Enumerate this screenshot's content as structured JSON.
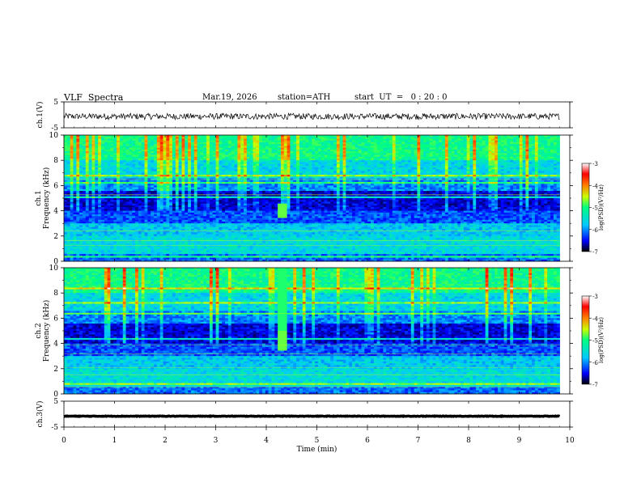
{
  "header": {
    "title": "VLF  Spectra",
    "date": "Mar.19, 2026",
    "station": "station=ATH",
    "start_ut": "start  UT  =   0 : 20 : 0"
  },
  "chart_data": [
    {
      "type": "line",
      "title": "",
      "ylabel": "ch.1(V)",
      "ylim": [
        -5,
        5
      ],
      "yticks": [
        "5",
        "-5"
      ],
      "series": [
        {
          "x_range": [
            0,
            9.8
          ],
          "baseline": -0.6,
          "amplitude_approx": 1.2
        }
      ],
      "color": "#000000"
    },
    {
      "type": "heatmap",
      "ylabel_line1": "ch.1",
      "ylabel_line2": "Frequency (kHz)",
      "ylim": [
        0,
        10
      ],
      "yticks": [
        "0",
        "2",
        "4",
        "6",
        "8",
        "10"
      ],
      "xlim": [
        0,
        10
      ],
      "data_xrange": [
        0,
        9.8
      ],
      "colorbar": {
        "label": "log(PSD)(V²/Hz)",
        "range": [
          -7,
          -3
        ],
        "ticks": [
          "-3",
          "-4",
          "-5",
          "-6",
          "-7"
        ],
        "colors": [
          "#000000",
          "#0000ff",
          "#00c8ff",
          "#00ff80",
          "#c8ff00",
          "#ff8000",
          "#ff0000",
          "#ffffff"
        ]
      },
      "features": {
        "strong_band_khz": [
          4,
          5.5
        ],
        "burst_time_min": [
          4.2,
          4.4
        ],
        "burst_freq_khz": [
          3.5,
          4.5
        ]
      }
    },
    {
      "type": "heatmap",
      "ylabel_line1": "ch.2",
      "ylabel_line2": "Frequency (kHz)",
      "ylim": [
        0,
        10
      ],
      "yticks": [
        "0",
        "2",
        "4",
        "6",
        "8",
        "10"
      ],
      "xlim": [
        0,
        10
      ],
      "data_xrange": [
        0,
        9.8
      ],
      "colorbar": {
        "label": "log(PSD)(V²/Hz)",
        "range": [
          -7,
          -3
        ],
        "ticks": [
          "-3",
          "-4",
          "-5",
          "-6",
          "-7"
        ],
        "colors": [
          "#000000",
          "#0000ff",
          "#00c8ff",
          "#00ff80",
          "#c8ff00",
          "#ff8000",
          "#ff0000",
          "#ffffff"
        ]
      },
      "features": {
        "strong_band_khz": [
          4,
          5.5
        ],
        "burst_time_min": [
          4.2,
          4.4
        ],
        "burst_freq_khz": [
          3.5,
          4.5
        ]
      }
    },
    {
      "type": "line",
      "ylabel": "ch.3(V)",
      "ylim": [
        -5,
        5
      ],
      "yticks": [
        "5",
        "-5"
      ],
      "series": [
        {
          "x_range": [
            0,
            9.8
          ],
          "baseline": -0.8,
          "amplitude_approx": 0.1
        }
      ],
      "color": "#000000"
    }
  ],
  "xaxis": {
    "label": "Time  (min)",
    "range": [
      0,
      10
    ],
    "ticks": [
      "0",
      "1",
      "2",
      "3",
      "4",
      "5",
      "6",
      "7",
      "8",
      "9",
      "10"
    ]
  }
}
